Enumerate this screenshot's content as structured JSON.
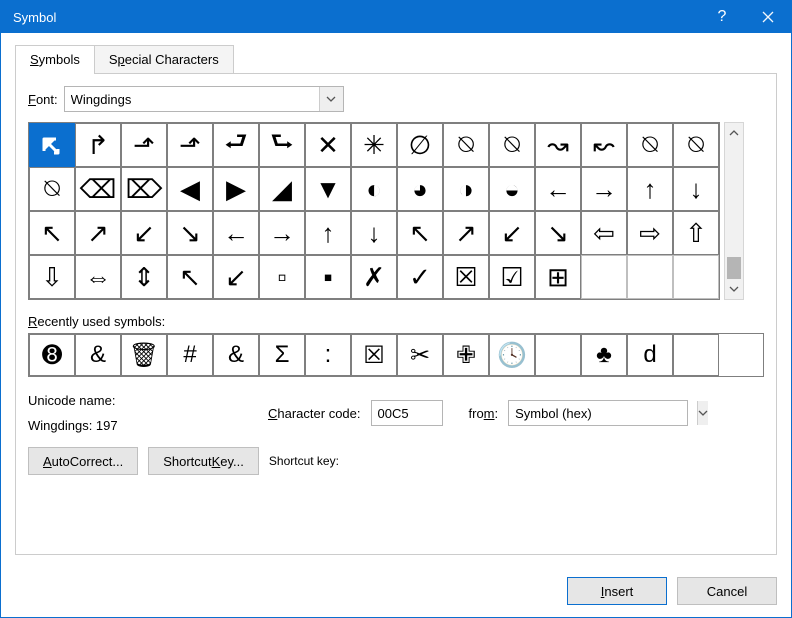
{
  "title": "Symbol",
  "tabs": {
    "symbols_label": "Symbols",
    "special_label": "Special Characters"
  },
  "font": {
    "label_prefix": "F",
    "label_underline": "o",
    "label_suffix": "nt:",
    "value": "Wingdings"
  },
  "grid": {
    "rows": [
      [
        "↰",
        "↱",
        "⬏",
        "⬏",
        "⮐",
        "⮑",
        "✕",
        "✳",
        "∅",
        "⍉",
        "⍉",
        "↝",
        "↜",
        "⍉",
        "⍉"
      ],
      [
        "⍉",
        "⌫",
        "⌦",
        "◀",
        "▶",
        "◢",
        "▼",
        "◐",
        "◕",
        "◑",
        "◒",
        "←",
        "→",
        "↑",
        "↓"
      ],
      [
        "↖",
        "↗",
        "↙",
        "↘",
        "←",
        "→",
        "↑",
        "↓",
        "↖",
        "↗",
        "↙",
        "↘",
        "⇦",
        "⇨",
        "⇧"
      ],
      [
        "⇩",
        "⇔",
        "⇕",
        "↖",
        "↙",
        "▫",
        "▪",
        "✗",
        "✓",
        "☒",
        "☑",
        "⊞",
        "",
        "",
        ""
      ]
    ],
    "selected_row": 0,
    "selected_col": 0
  },
  "recent": {
    "label": "Recently used symbols:",
    "items": [
      "➑",
      "&",
      "🗑",
      "#",
      "&",
      "Σ",
      ":",
      "☒",
      "✂",
      "✙",
      "🕓",
      "",
      "♣",
      "d",
      ""
    ]
  },
  "unicode_name_label": "Unicode name:",
  "unicode_name_value": "Wingdings: 197",
  "char_code": {
    "label": "Character code:",
    "value": "00C5"
  },
  "from": {
    "label": "from:",
    "value": "Symbol (hex)"
  },
  "autocorrect_label": "AutoCorrect...",
  "shortcut_key_btn": "Shortcut Key...",
  "shortcut_key_label": "Shortcut key:",
  "shortcut_key_value": "",
  "footer": {
    "insert": "Insert",
    "cancel": "Cancel"
  }
}
